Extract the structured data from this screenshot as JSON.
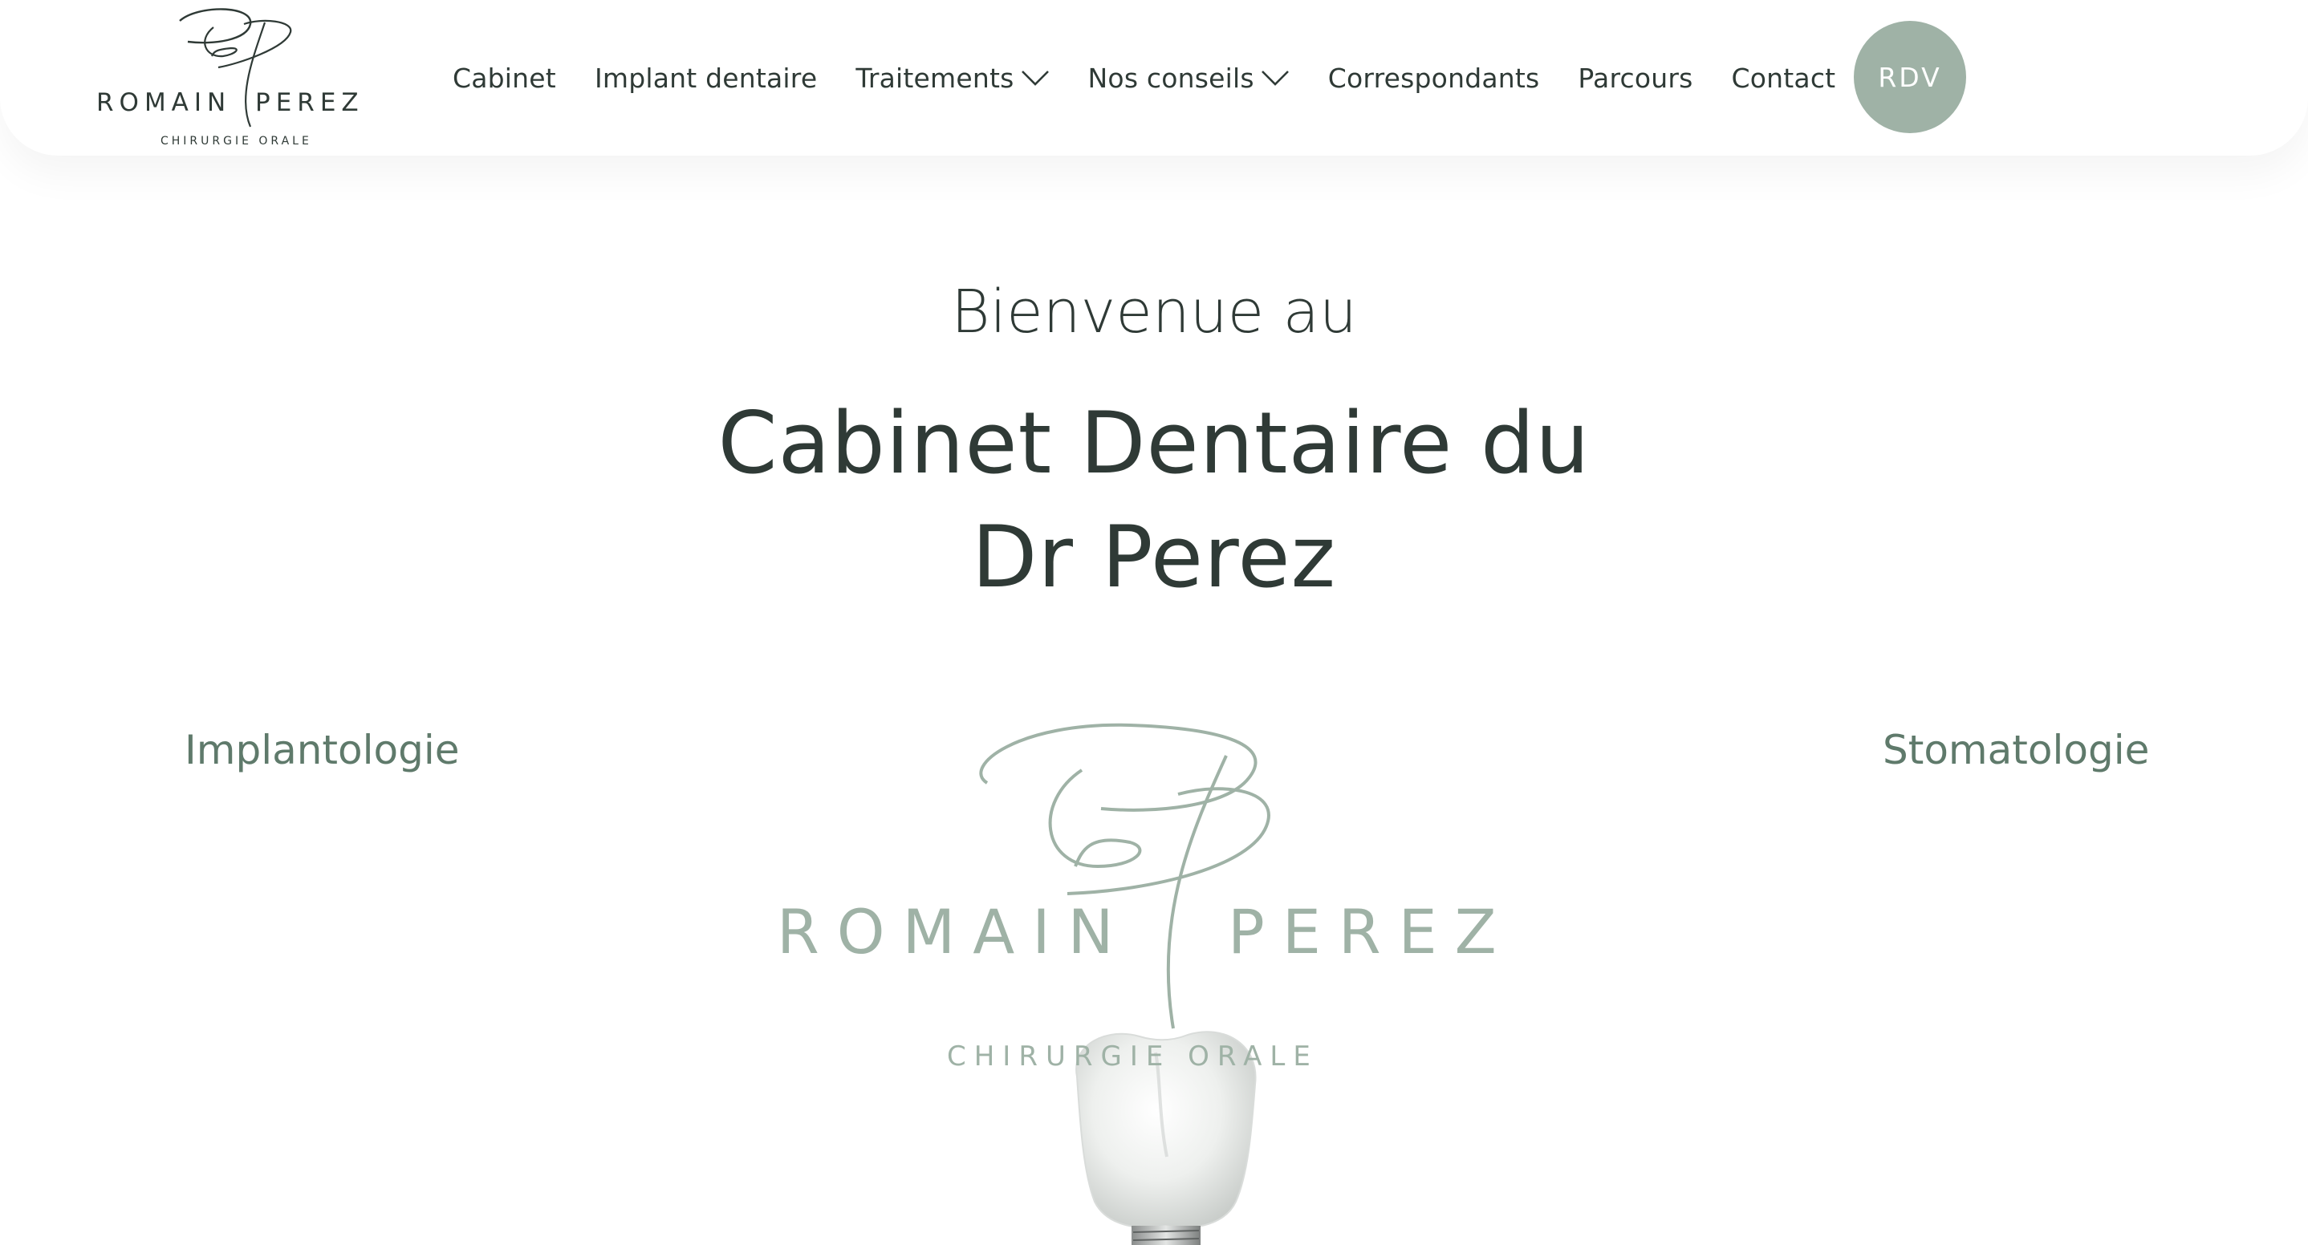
{
  "brand": {
    "name_first": "ROMAIN",
    "name_last": "PEREZ",
    "tagline": "CHIRURGIE ORALE",
    "monogram": "RP",
    "accent_color": "#9fb2a6",
    "text_color": "#2f3a36",
    "link_color": "#5f7a6b"
  },
  "nav": {
    "items": [
      {
        "label": "Cabinet",
        "dropdown": false
      },
      {
        "label": "Implant dentaire",
        "dropdown": false
      },
      {
        "label": "Traitements",
        "dropdown": true,
        "icon": "chevron-down-icon"
      },
      {
        "label": "Nos conseils",
        "dropdown": true,
        "icon": "chevron-down-icon"
      },
      {
        "label": "Correspondants",
        "dropdown": false
      },
      {
        "label": "Parcours",
        "dropdown": false
      },
      {
        "label": "Contact",
        "dropdown": false
      }
    ],
    "cta_label": "RDV"
  },
  "hero": {
    "subtitle": "Bienvenue au",
    "title_line1": "Cabinet Dentaire du",
    "title_line2": "Dr Perez"
  },
  "sections": {
    "left_link": "Implantologie",
    "right_link": "Stomatologie"
  }
}
